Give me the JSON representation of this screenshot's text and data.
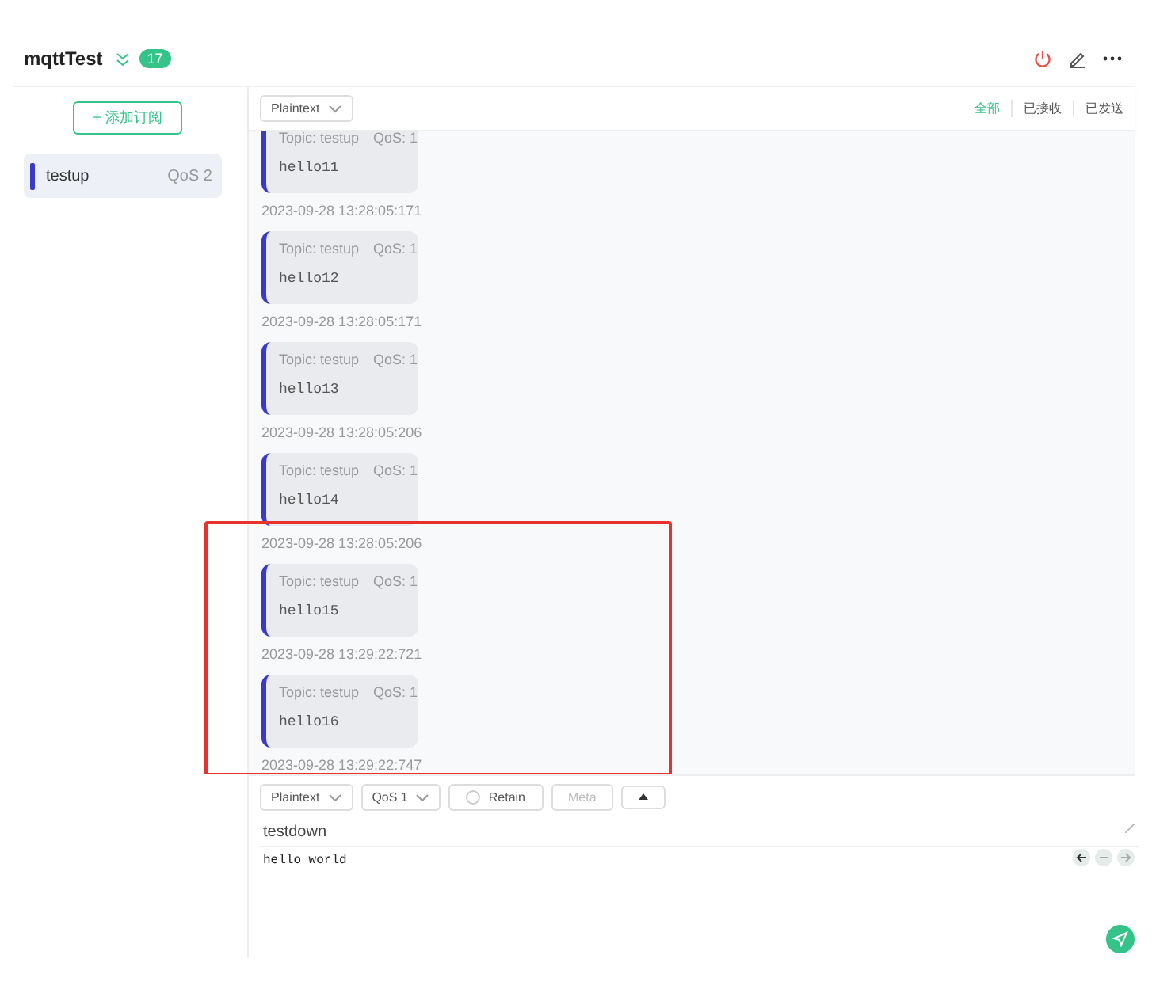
{
  "header": {
    "title": "mqttTest",
    "badge": "17"
  },
  "sidebar": {
    "add_button": "+ 添加订阅",
    "subscriptions": [
      {
        "topic": "testup",
        "qos": "QoS 2",
        "color": "#3a3ac8",
        "selected": true
      }
    ]
  },
  "toolbar": {
    "format": "Plaintext",
    "filters": [
      {
        "label": "全部",
        "selected": true
      },
      {
        "label": "已接收",
        "selected": false
      },
      {
        "label": "已发送",
        "selected": false
      }
    ]
  },
  "messages": [
    {
      "topic": "Topic: testup",
      "qos": "QoS: 1",
      "payload": "hello11",
      "time": "2023-09-28 13:28:05:171",
      "highlighted": false
    },
    {
      "topic": "Topic: testup",
      "qos": "QoS: 1",
      "payload": "hello12",
      "time": "2023-09-28 13:28:05:171",
      "highlighted": false
    },
    {
      "topic": "Topic: testup",
      "qos": "QoS: 1",
      "payload": "hello13",
      "time": "2023-09-28 13:28:05:206",
      "highlighted": false
    },
    {
      "topic": "Topic: testup",
      "qos": "QoS: 1",
      "payload": "hello14",
      "time": "2023-09-28 13:28:05:206",
      "highlighted": false
    },
    {
      "topic": "Topic: testup",
      "qos": "QoS: 1",
      "payload": "hello15",
      "time": "2023-09-28 13:29:22:721",
      "highlighted": true
    },
    {
      "topic": "Topic: testup",
      "qos": "QoS: 1",
      "payload": "hello16",
      "time": "2023-09-28 13:29:22:747",
      "highlighted": true
    }
  ],
  "composer": {
    "format": "Plaintext",
    "qos": "QoS 1",
    "retain": {
      "label": "Retain",
      "checked": false
    },
    "meta": "Meta",
    "topic": "testdown",
    "payload": "hello world"
  }
}
